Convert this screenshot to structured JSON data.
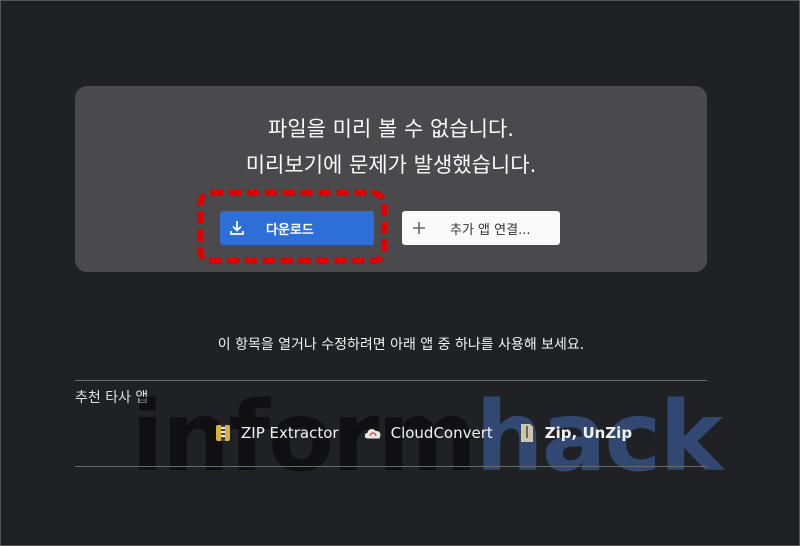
{
  "preview": {
    "line1": "파일을 미리 볼 수 없습니다.",
    "line2": "미리보기에 문제가 발생했습니다."
  },
  "buttons": {
    "download": {
      "label": "다운로드",
      "icon": "download-icon"
    },
    "open_more": {
      "label": "추가 앱 연결...",
      "icon": "plus-icon"
    }
  },
  "hint": "이 항목을 열거나 수정하려면 아래 앱 중 하나를 사용해 보세요.",
  "recommended": {
    "title": "추천 타사 앱",
    "apps": [
      {
        "name": "ZIP Extractor",
        "icon": "zip-extractor-icon"
      },
      {
        "name": "CloudConvert",
        "icon": "cloudconvert-icon"
      },
      {
        "name": "Zip, UnZip",
        "icon": "zip-unzip-icon"
      }
    ]
  },
  "watermark": {
    "part1": "inform",
    "part2": "hack"
  },
  "colors": {
    "accent": "#2d6ed9",
    "highlight": "#e00000",
    "card": "#4a4a4c"
  }
}
